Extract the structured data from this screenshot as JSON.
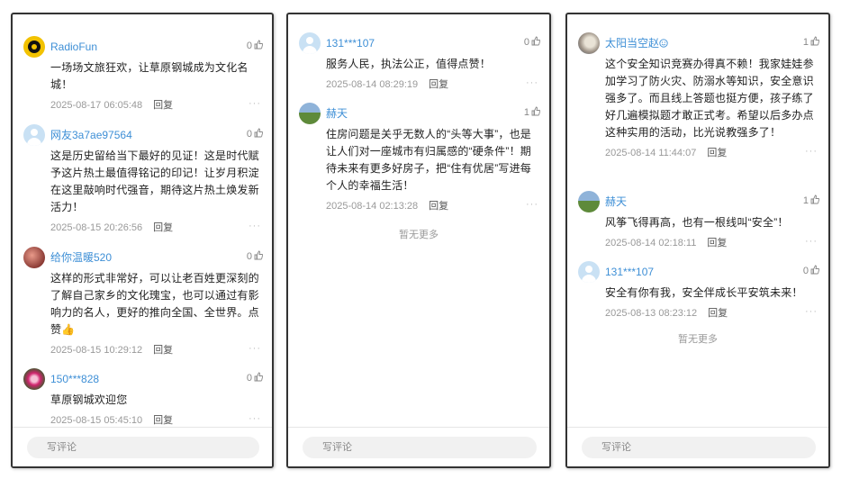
{
  "panels": [
    {
      "comments": [
        {
          "avatar": "radio-icon",
          "user": "RadioFun",
          "likes": "0",
          "text": "一场场文旅狂欢，让草原钢城成为文化名城！",
          "time": "2025-08-17 06:05:48",
          "reply": "回复",
          "more": "···"
        },
        {
          "avatar": "default-avatar-icon",
          "user": "网友3a7ae97564",
          "likes": "0",
          "text": "这是历史留给当下最好的见证！这是时代赋予这片热土最值得铭记的印记！让岁月积淀在这里敲响时代强音，期待这片热土焕发新活力！",
          "time": "2025-08-15 20:26:56",
          "reply": "回复",
          "more": "···"
        },
        {
          "avatar": "photo-avatar-icon",
          "user": "给你温暖520",
          "likes": "0",
          "text": "这样的形式非常好，可以让老百姓更深刻的了解自己家乡的文化瑰宝，也可以通过有影响力的名人，更好的推向全国、全世界。点赞👍",
          "time": "2025-08-15 10:29:12",
          "reply": "回复",
          "more": "···"
        },
        {
          "avatar": "flower-avatar-icon",
          "user": "150***828",
          "likes": "0",
          "text": "草原钢城欢迎您",
          "time": "2025-08-15 05:45:10",
          "reply": "回复",
          "more": "···"
        }
      ],
      "no_more": "",
      "input_placeholder": "写评论"
    },
    {
      "comments": [
        {
          "avatar": "default-avatar-icon",
          "user": "131***107",
          "likes": "0",
          "text": "服务人民，执法公正，值得点赞！",
          "time": "2025-08-14 08:29:19",
          "reply": "回复",
          "more": "···"
        },
        {
          "avatar": "field-avatar-icon",
          "user": "赫天",
          "likes": "1",
          "text": "住房问题是关乎无数人的“头等大事”，也是让人们对一座城市有归属感的“硬条件”！期待未来有更多好房子，把“住有优居”写进每个人的幸福生活！",
          "time": "2025-08-14 02:13:28",
          "reply": "回复",
          "more": "···"
        }
      ],
      "no_more": "暂无更多",
      "input_placeholder": "写评论"
    },
    {
      "comments": [
        {
          "avatar": "photo-avatar-icon",
          "user": "太阳当空赵",
          "user_emoji": "smile-icon",
          "likes": "1",
          "text": "这个安全知识竞赛办得真不赖！我家娃娃参加学习了防火灾、防溺水等知识，安全意识强多了。而且线上答题也挺方便，孩子练了好几遍模拟题才敢正式考。希望以后多办点这种实用的活动，比光说教强多了！",
          "time": "2025-08-14 11:44:07",
          "reply": "回复",
          "more": "···"
        },
        {
          "avatar": "field-avatar-icon",
          "user": "赫天",
          "likes": "1",
          "text": "风筝飞得再高，也有一根线叫“安全”！",
          "time": "2025-08-14 02:18:11",
          "reply": "回复",
          "more": "···"
        },
        {
          "avatar": "default-avatar-icon",
          "user": "131***107",
          "likes": "0",
          "text": "安全有你有我，安全伴成长平安筑未来！",
          "time": "2025-08-13 08:23:12",
          "reply": "回复",
          "more": "···"
        }
      ],
      "no_more": "暂无更多",
      "input_placeholder": "写评论"
    }
  ]
}
